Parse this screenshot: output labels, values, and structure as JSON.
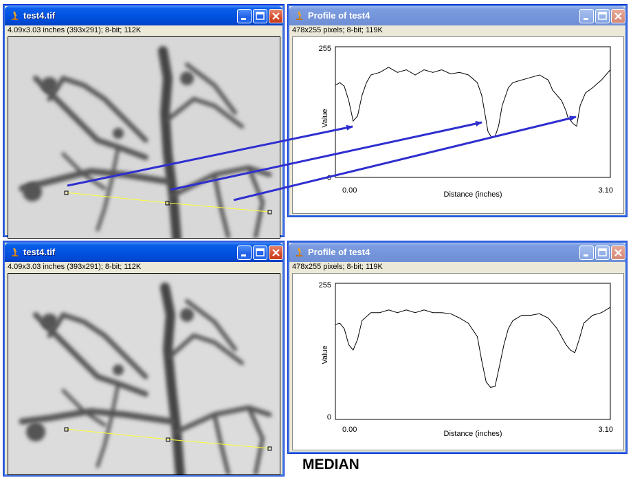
{
  "windows": {
    "image_top": {
      "title": "test4.tif",
      "info": "4.09x3.03 inches (393x291); 8-bit; 112K"
    },
    "profile_top": {
      "title": "Profile of test4",
      "info": "478x255 pixels; 8-bit; 119K",
      "chart_data": {
        "type": "line",
        "xlabel": "Distance (inches)",
        "ylabel": "Value",
        "x_tick_labels": [
          "0.00",
          "3.10"
        ],
        "y_tick_labels": [
          "0",
          "255"
        ],
        "xlim": [
          0,
          3.1
        ],
        "ylim": [
          0,
          255
        ],
        "x": [
          0.0,
          0.05,
          0.1,
          0.15,
          0.2,
          0.25,
          0.3,
          0.35,
          0.4,
          0.5,
          0.6,
          0.7,
          0.8,
          0.9,
          1.0,
          1.1,
          1.2,
          1.3,
          1.4,
          1.5,
          1.6,
          1.65,
          1.7,
          1.72,
          1.76,
          1.8,
          1.84,
          1.88,
          1.95,
          2.0,
          2.1,
          2.2,
          2.3,
          2.4,
          2.45,
          2.55,
          2.6,
          2.62,
          2.68,
          2.72,
          2.76,
          2.82,
          2.9,
          3.0,
          3.1
        ],
        "y": [
          180,
          185,
          178,
          150,
          110,
          120,
          160,
          185,
          200,
          205,
          215,
          205,
          210,
          200,
          210,
          205,
          210,
          202,
          205,
          200,
          185,
          160,
          110,
          90,
          78,
          80,
          100,
          140,
          175,
          185,
          190,
          195,
          200,
          190,
          170,
          150,
          130,
          118,
          105,
          100,
          140,
          165,
          175,
          190,
          210
        ],
        "arrows": 3
      }
    },
    "image_bottom": {
      "title": "test4.tif",
      "info": "4.09x3.03 inches (393x291); 8-bit; 112K"
    },
    "profile_bottom": {
      "title": "Profile of test4",
      "info": "478x255 pixels; 8-bit; 119K",
      "chart_data": {
        "type": "line",
        "xlabel": "Distance (inches)",
        "ylabel": "Value",
        "x_tick_labels": [
          "0.00",
          "3.10"
        ],
        "y_tick_labels": [
          "0",
          "255"
        ],
        "xlim": [
          0,
          3.1
        ],
        "ylim": [
          0,
          255
        ],
        "x": [
          0.0,
          0.05,
          0.1,
          0.15,
          0.2,
          0.25,
          0.3,
          0.4,
          0.5,
          0.6,
          0.7,
          0.8,
          0.9,
          1.0,
          1.1,
          1.2,
          1.3,
          1.4,
          1.5,
          1.6,
          1.65,
          1.7,
          1.75,
          1.8,
          1.85,
          1.9,
          1.95,
          2.0,
          2.1,
          2.2,
          2.3,
          2.4,
          2.5,
          2.6,
          2.65,
          2.7,
          2.75,
          2.8,
          2.9,
          3.0,
          3.1
        ],
        "y": [
          178,
          180,
          170,
          140,
          130,
          150,
          185,
          200,
          200,
          205,
          200,
          205,
          200,
          205,
          200,
          200,
          198,
          190,
          180,
          155,
          110,
          70,
          60,
          62,
          100,
          140,
          170,
          185,
          195,
          195,
          198,
          190,
          170,
          140,
          130,
          125,
          150,
          180,
          195,
          200,
          210
        ]
      }
    }
  },
  "caption": "MEDIAN"
}
